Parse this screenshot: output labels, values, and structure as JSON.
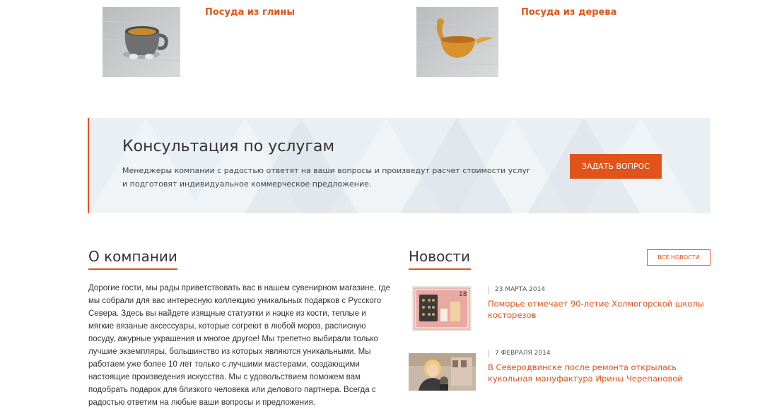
{
  "categories": [
    {
      "title": "Посуда из глины",
      "image": "clay-cup-image"
    },
    {
      "title": "Посуда из дерева",
      "image": "wooden-ladle-image"
    }
  ],
  "banner": {
    "title": "Консультация по услугам",
    "text": "Менеджеры компании с радостью ответят на ваши вопросы и произведут расчет стоимости услуг и подготовят индивидуальное коммерческое предложение.",
    "button_label": "Задать вопрос"
  },
  "about": {
    "title": "О компании",
    "text": "Дорогие гости, мы рады приветствовать вас в нашем сувенирном магазине, где мы собрали для вас интересную коллекцию уникальных подарков с Русского Севера. Здесь вы найдете изящные статуэтки и нэцке из кости, теплые и мягкие вязаные аксессуары, которые согреют в любой мороз, расписную посуду, ажурные украшения и многое другое! Мы трепетно выбирали только лучшие экземпляры, большинство из которых являются уникальными. Мы работаем уже более 10 лет только с лучшими мастерами, создающими настоящие произведения искусства. Мы с удовольствием поможем вам подобрать подарок для близкого человека или делового партнера. Всегда с радостью ответим на любые ваши вопросы и предложения."
  },
  "news": {
    "title": "Новости",
    "all_label": "Все новости",
    "items": [
      {
        "date": "23 марта 2014",
        "title": "Поморье отмечает 90-летие Холмогорской школы косторезов"
      },
      {
        "date": "7 февраля 2014",
        "title": "В Северодвинске после ремонта открылась кукольная мануфактура Ирины Черепановой"
      }
    ]
  },
  "colors": {
    "accent": "#e0541c",
    "banner_bg": "#eaeff3",
    "text": "#333333"
  }
}
